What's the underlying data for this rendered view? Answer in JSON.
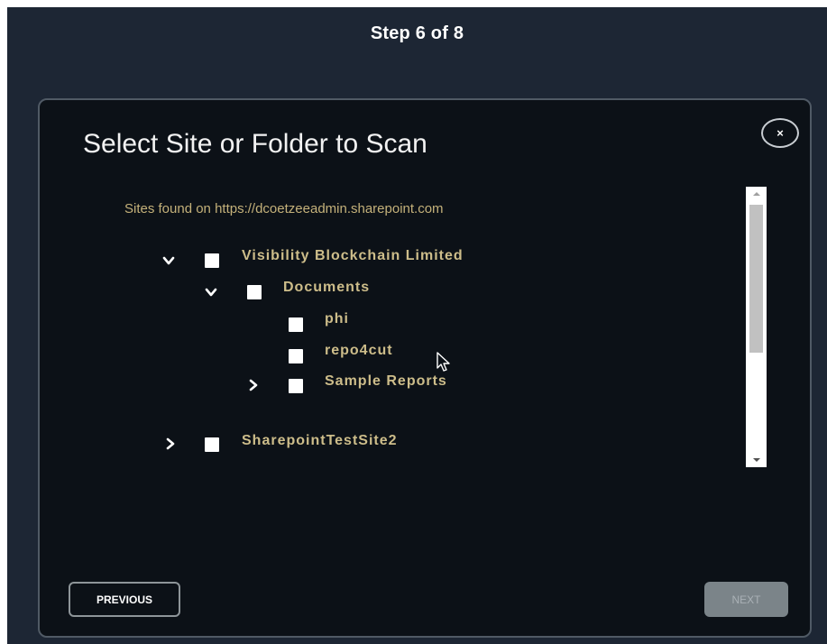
{
  "wizard": {
    "step_label": "Step 6 of  8"
  },
  "dialog": {
    "title": "Select Site or Folder to Scan",
    "close_label": "×",
    "sites_caption": "Sites found on https://dcoetzeeadmin.sharepoint.com"
  },
  "tree": {
    "nodes": [
      {
        "label": "Visibility Blockchain Limited",
        "expanded": true,
        "checked": false,
        "level": 0
      },
      {
        "label": "Documents",
        "expanded": true,
        "checked": false,
        "level": 1
      },
      {
        "label": "phi",
        "checked": false,
        "level": 2
      },
      {
        "label": "repo4cut",
        "checked": false,
        "level": 2
      },
      {
        "label": "Sample Reports",
        "expanded": false,
        "checked": false,
        "level": 2
      },
      {
        "label": "SharepointTestSite2",
        "expanded": false,
        "checked": false,
        "level": 0
      }
    ]
  },
  "footer": {
    "previous_label": "PREVIOUS",
    "next_label": "NEXT"
  },
  "colors": {
    "background": "#1d2634",
    "dialog_background": "#0c1117",
    "tree_label": "#cdbd8a",
    "caption": "#c4b17a"
  },
  "icons": {
    "close": "close-icon",
    "expanded": "chevron-down-icon",
    "collapsed": "chevron-right-icon",
    "pointer": "mouse-pointer-icon"
  }
}
